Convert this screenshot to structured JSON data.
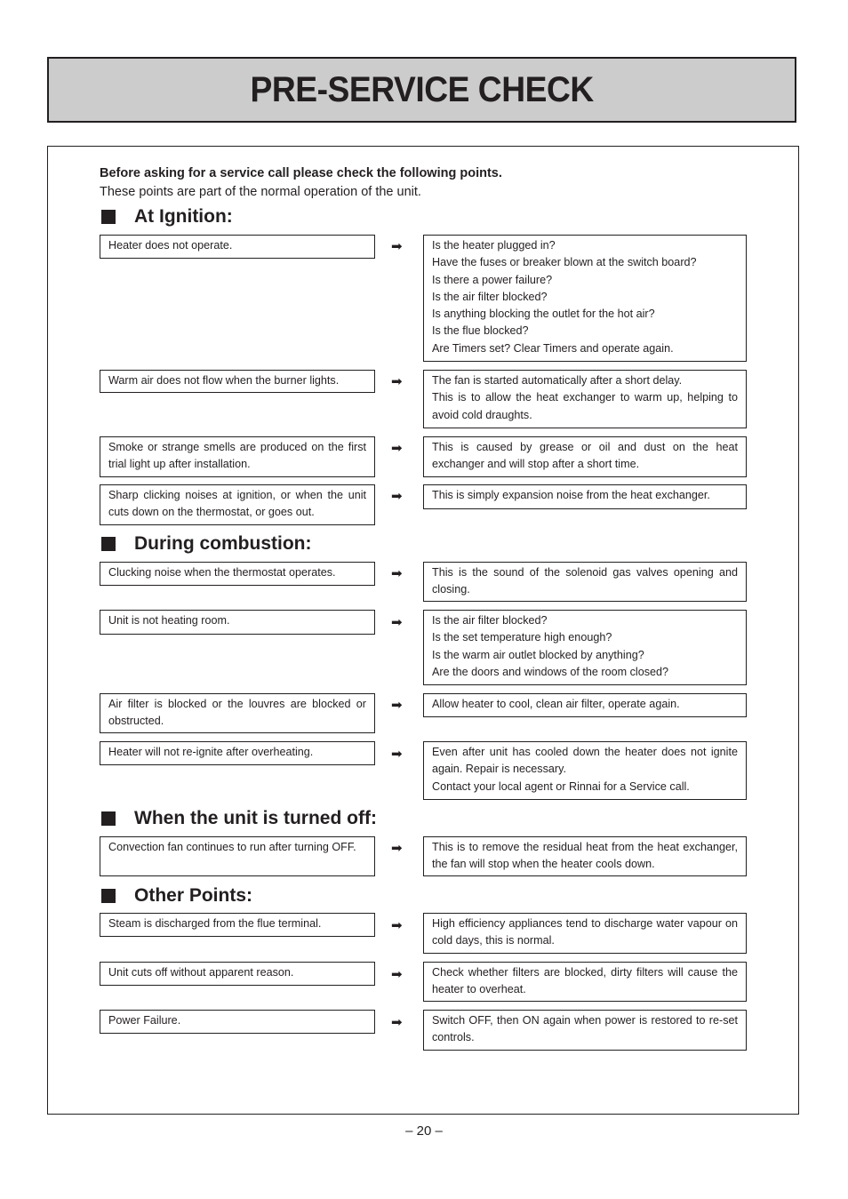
{
  "page": {
    "title": "PRE-SERVICE CHECK",
    "intro_bold": "Before asking for a service call please check the following points.",
    "intro_plain": "These points are part of the normal operation of the unit.",
    "page_number": "– 20 –",
    "arrow_icon": "➡"
  },
  "sections": [
    {
      "heading": "At Ignition:",
      "rows": [
        {
          "problem": "Heater does not operate.",
          "answer_lines": [
            "Is the heater plugged in?",
            "Have the fuses or breaker blown at the switch board?",
            "Is there a power failure?",
            "Is the air filter blocked?",
            "Is anything blocking the outlet for the hot air?",
            "Is the flue blocked?",
            "Are Timers set?  Clear Timers and operate again."
          ]
        },
        {
          "problem": "Warm air does not flow when the burner lights.",
          "answer_lines": [
            "The fan is started automatically after a short delay.",
            "This is to allow the heat exchanger to warm up, helping to avoid cold draughts."
          ]
        },
        {
          "problem": "Smoke or strange smells are produced on the first trial light up after installation.",
          "answer_lines": [
            "This is caused by grease or oil and dust on the heat exchanger and will stop after a short time."
          ]
        },
        {
          "problem": "Sharp clicking noises at ignition, or when the unit cuts down on the thermostat, or goes out.",
          "answer_lines": [
            "This is simply expansion noise from the heat exchanger."
          ]
        }
      ]
    },
    {
      "heading": "During combustion:",
      "rows": [
        {
          "problem": "Clucking noise when the thermostat operates.",
          "answer_lines": [
            "This is the sound of the solenoid gas valves opening and closing."
          ]
        },
        {
          "problem": "Unit is not heating room.",
          "answer_lines": [
            "Is the air filter blocked?",
            "Is the set temperature high enough?",
            "Is the warm air outlet blocked by anything?",
            "Are the doors and windows of the room closed?"
          ]
        },
        {
          "problem": "Air filter is blocked or the louvres are blocked or obstructed.",
          "answer_lines": [
            "Allow heater to cool, clean air filter, operate again."
          ]
        },
        {
          "problem": "Heater will not re-ignite after overheating.",
          "answer_lines": [
            "Even after unit has cooled down the heater does not ignite again.  Repair is necessary.",
            "Contact your local agent or Rinnai for a Service call."
          ]
        }
      ]
    },
    {
      "heading": "When the unit is turned off:",
      "rows": [
        {
          "problem": "Convection fan continues to run after turning OFF.",
          "answer_lines": [
            "This is to remove the residual heat from the heat exchanger, the fan will stop when the heater cools down."
          ]
        }
      ]
    },
    {
      "heading": "Other Points:",
      "rows": [
        {
          "problem": "Steam is discharged from the flue terminal.",
          "answer_lines": [
            "High efficiency appliances tend to discharge water vapour on cold days, this is normal."
          ]
        },
        {
          "problem": "Unit cuts off without apparent reason.",
          "answer_lines": [
            "Check whether filters are blocked, dirty filters will cause the heater to overheat."
          ]
        },
        {
          "problem": "Power Failure.",
          "answer_lines": [
            "Switch OFF, then ON again when power is restored to re-set controls."
          ]
        }
      ]
    }
  ]
}
